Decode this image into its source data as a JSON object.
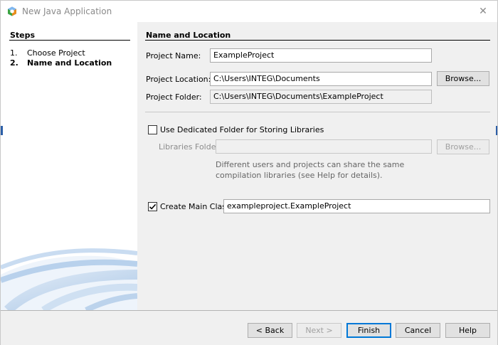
{
  "window": {
    "title": "New Java Application",
    "close_glyph": "✕",
    "icon": "netbeans-cube-icon"
  },
  "steps": {
    "title": "Steps",
    "items": [
      {
        "num": "1.",
        "label": "Choose Project",
        "current": false
      },
      {
        "num": "2.",
        "label": "Name and Location",
        "current": true
      }
    ]
  },
  "form": {
    "section_title": "Name and Location",
    "project_name": {
      "label": "Project Name:",
      "value": "ExampleProject"
    },
    "project_location": {
      "label": "Project Location:",
      "value": "C:\\Users\\INTEG\\Documents"
    },
    "project_folder": {
      "label": "Project Folder:",
      "value": "C:\\Users\\INTEG\\Documents\\ExampleProject"
    },
    "browse_label": "Browse...",
    "dedicated_folder": {
      "label": "Use Dedicated Folder for Storing Libraries",
      "checked": false
    },
    "libraries_folder": {
      "label": "Libraries Folder:",
      "value": ""
    },
    "libraries_browse_label": "Browse...",
    "libraries_help": "Different users and projects can share the same compilation libraries (see Help for details).",
    "create_main_class": {
      "label": "Create Main Class",
      "checked": true,
      "value": "exampleproject.ExampleProject"
    }
  },
  "buttons": {
    "back": "< Back",
    "next": "Next >",
    "finish": "Finish",
    "cancel": "Cancel",
    "help": "Help"
  },
  "colors": {
    "accent": "#0078d7",
    "panel_bg": "#f0f0f0",
    "swirl": "#a9c6e6"
  }
}
